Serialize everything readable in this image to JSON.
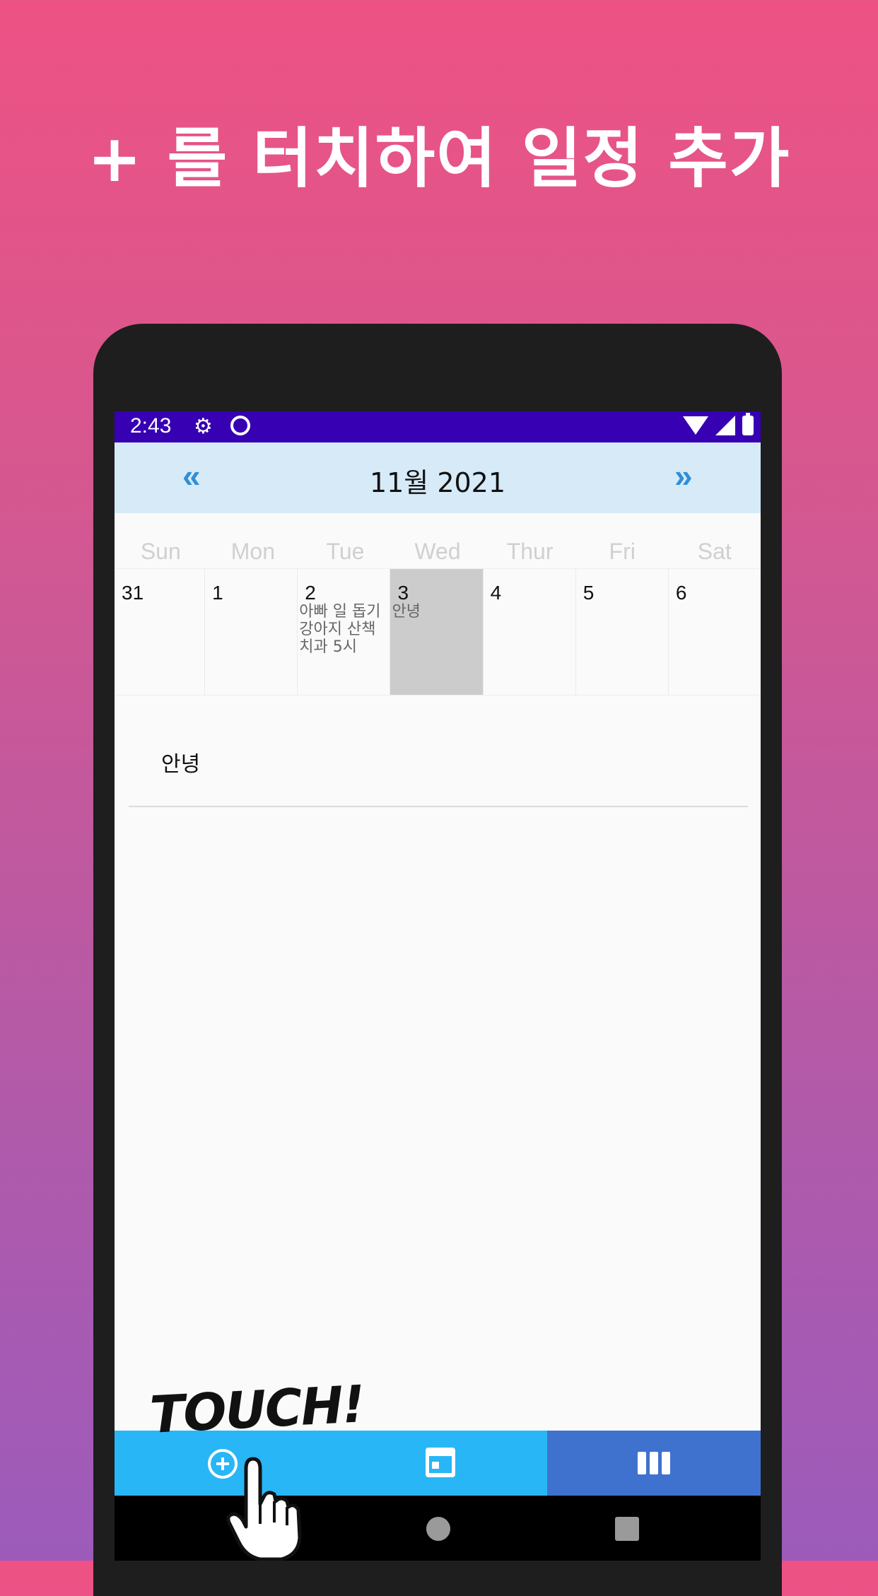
{
  "headline": "+ 를 터치하여 일정 추가",
  "status": {
    "time": "2:43"
  },
  "calendar": {
    "prev_label": "«",
    "next_label": "»",
    "month_title": "11월 2021",
    "weekdays": [
      "Sun",
      "Mon",
      "Tue",
      "Wed",
      "Thur",
      "Fri",
      "Sat"
    ],
    "days": [
      {
        "num": "31",
        "events": []
      },
      {
        "num": "1",
        "events": []
      },
      {
        "num": "2",
        "events": [
          "아빠 일 돕기",
          "강아지 산책",
          "치과 5시"
        ]
      },
      {
        "num": "3",
        "events": [
          "안녕"
        ],
        "selected": true
      },
      {
        "num": "4",
        "events": []
      },
      {
        "num": "5",
        "events": []
      },
      {
        "num": "6",
        "events": []
      }
    ]
  },
  "detail": {
    "items": [
      "안녕"
    ]
  },
  "touch_label": "TOUCH!",
  "colors": {
    "statusbar": "#3700b3",
    "monthbar": "#d6eaf7",
    "nav_primary": "#29b6f6",
    "nav_active": "#3f72cf"
  }
}
